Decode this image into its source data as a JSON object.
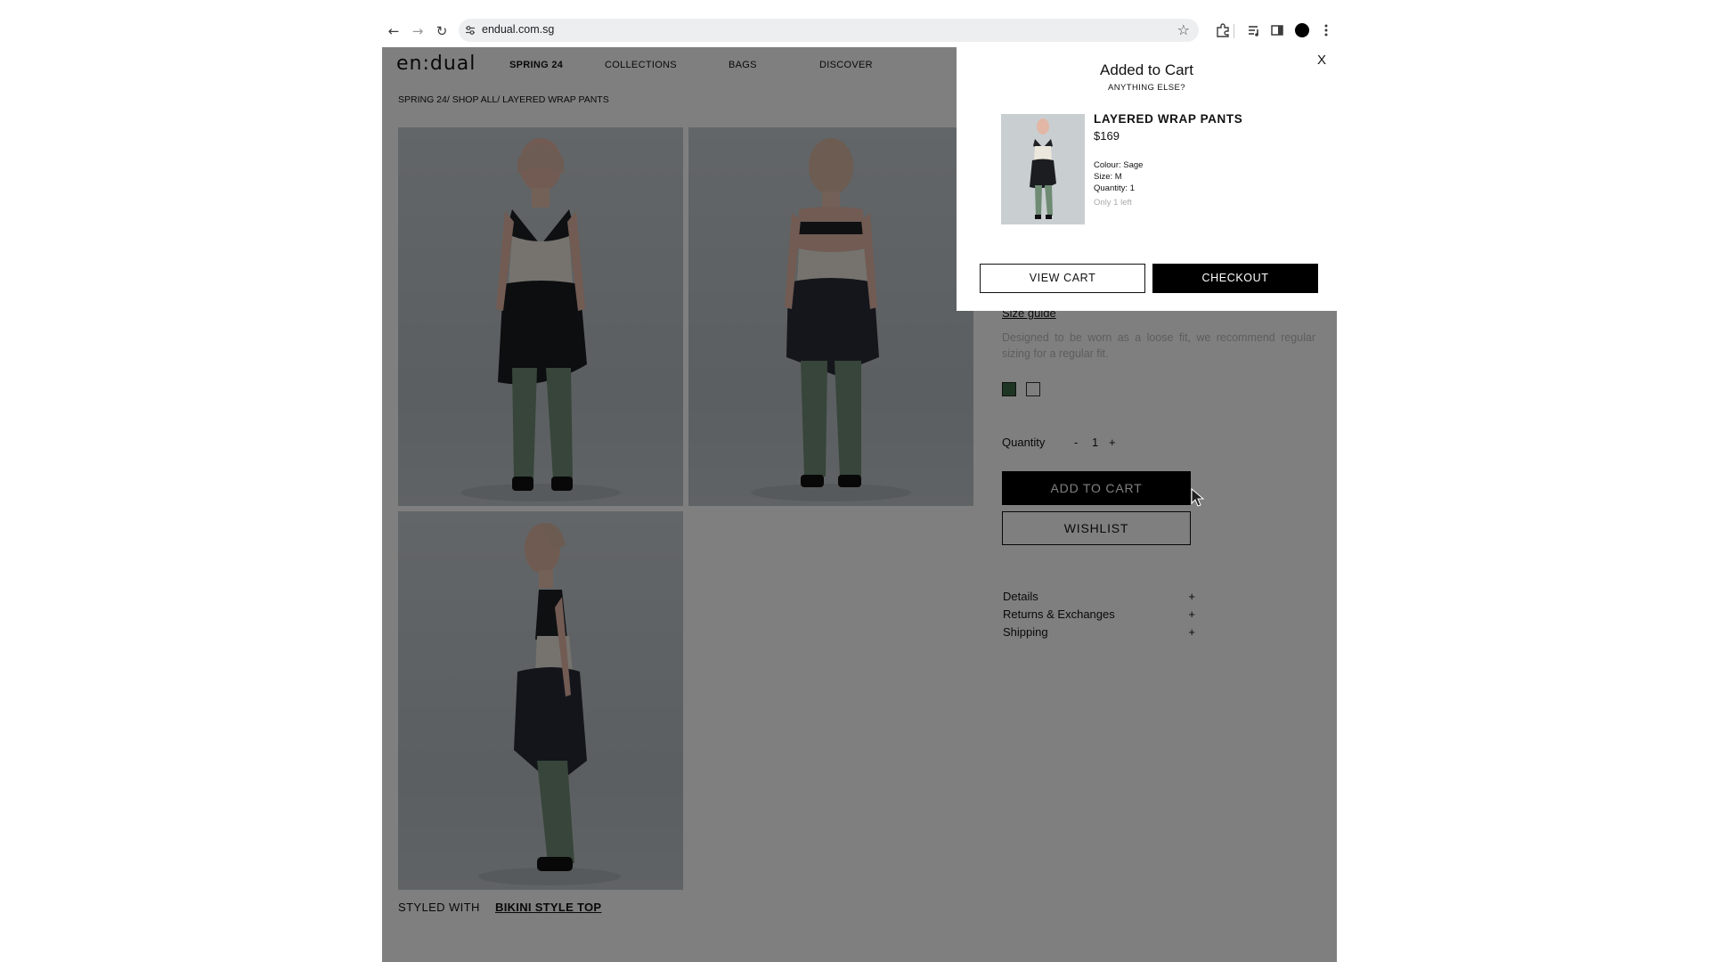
{
  "browser": {
    "url": "endual.com.sg",
    "back_icon": "←",
    "forward_icon": "→",
    "reload_icon": "↻",
    "star_icon": "☆"
  },
  "site": {
    "logo": "en:dual",
    "nav": [
      "SPRING 24",
      "COLLECTIONS",
      "BAGS",
      "DISCOVER"
    ],
    "breadcrumb": "SPRING 24/ SHOP ALL/ LAYERED WRAP PANTS",
    "styled_with_label": "STYLED WITH",
    "styled_with_link": "BIKINI STYLE TOP"
  },
  "product": {
    "size_guide": "Size guide",
    "fit_note": "Designed to be worn as a loose fit, we recommend regular sizing for a regular fit.",
    "swatches": [
      "#3e6b48",
      "#ffffff"
    ],
    "quantity_label": "Quantity",
    "quantity_minus": "-",
    "quantity_value": "1",
    "quantity_plus": "+",
    "add_to_cart": "ADD TO CART",
    "wishlist": "WISHLIST",
    "accordion": [
      {
        "label": "Details",
        "icon": "+"
      },
      {
        "label": "Returns & Exchanges",
        "icon": "+"
      },
      {
        "label": "Shipping",
        "icon": "+"
      }
    ]
  },
  "cart_popup": {
    "close": "X",
    "title": "Added to Cart",
    "subtitle": "ANYTHING ELSE?",
    "item_name": "LAYERED WRAP PANTS",
    "item_price": "$169",
    "colour": "Colour: Sage",
    "size": "Size: M",
    "quantity": "Quantity: 1",
    "stock": "Only 1 left",
    "view_cart": "VIEW CART",
    "checkout": "CHECKOUT"
  }
}
